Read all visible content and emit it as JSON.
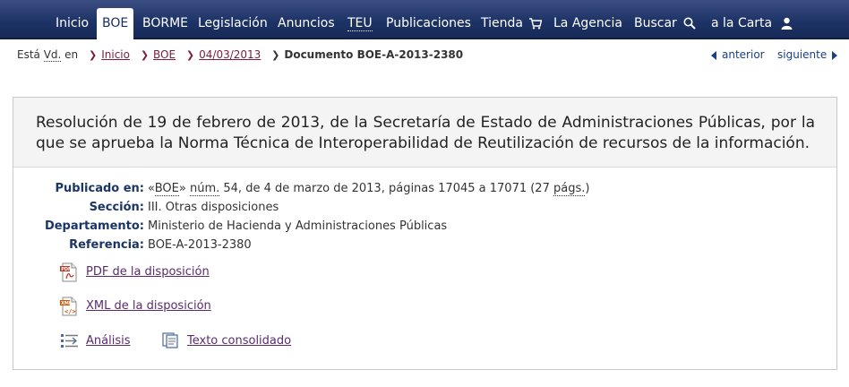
{
  "nav": {
    "items": [
      {
        "label": "Inicio"
      },
      {
        "label": "BOE"
      },
      {
        "label": "BORME"
      },
      {
        "label": "Legislación"
      },
      {
        "label": "Anuncios"
      },
      {
        "label": "TEU"
      },
      {
        "label": "Publicaciones"
      },
      {
        "label": "Tienda"
      },
      {
        "label": "La Agencia"
      },
      {
        "label": "Buscar"
      },
      {
        "label": "a la Carta"
      }
    ],
    "active": "BOE"
  },
  "breadcrumb": {
    "prefix_a": "Está ",
    "prefix_abbr": "Vd.",
    "prefix_b": " en",
    "links": [
      "Inicio",
      "BOE",
      "04/03/2013"
    ],
    "current": "Documento BOE-A-2013-2380"
  },
  "pager": {
    "prev": "anterior",
    "next": "siguiente"
  },
  "document": {
    "title": "Resolución de 19 de febrero de 2013, de la Secretaría de Estado de Administraciones Públicas, por la que se aprueba la Norma Técnica de Interoperabilidad de Reutilización de recursos de la información.",
    "published_label": "Publicado en:",
    "published_quote_open": "«",
    "published_boe": "BOE",
    "published_quote_close": "» ",
    "published_num": "núm.",
    "published_mid": " 54, de 4 de marzo de 2013, páginas 17045 a 17071 (27 ",
    "published_pags": "págs.",
    "published_end": ")",
    "section_label": "Sección:",
    "section_value": "III. Otras disposiciones",
    "department_label": "Departamento:",
    "department_value": "Ministerio de Hacienda y Administraciones Públicas",
    "reference_label": "Referencia:",
    "reference_value": "BOE-A-2013-2380"
  },
  "links": {
    "pdf": "PDF de la disposición",
    "xml": "XML de la disposición",
    "analysis": "Análisis",
    "consolidated": "Texto consolidado"
  },
  "colors": {
    "nav_bg": "#1e3366",
    "label_blue": "#1b3565",
    "link_purple": "#5b2a6e",
    "crumb_red": "#7a1e3a"
  }
}
